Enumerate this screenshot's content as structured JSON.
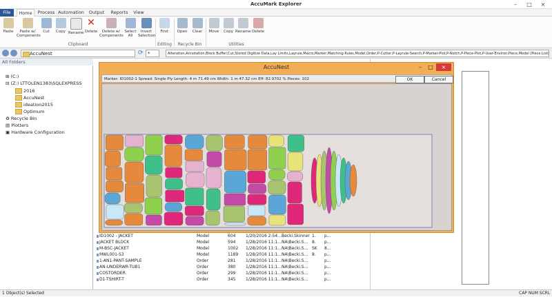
{
  "app": {
    "title": "AccuMark Explorer"
  },
  "tabs": [
    {
      "label": "File"
    },
    {
      "label": "Home"
    },
    {
      "label": "Process"
    },
    {
      "label": "Automation"
    },
    {
      "label": "Output"
    },
    {
      "label": "Reports"
    },
    {
      "label": "View"
    }
  ],
  "ribbon": {
    "clipboard": {
      "group_label": "Clipboard",
      "buttons": [
        "Paste",
        "Paste w/ Components",
        "Cut",
        "Copy",
        "Rename",
        "Delete",
        "Delete w/ Components",
        "Select All",
        "Invert Selection"
      ]
    },
    "editing": {
      "group_label": "Editing",
      "buttons": [
        "Find"
      ]
    },
    "recycle": {
      "group_label": "Recycle Bin",
      "buttons": [
        "Open",
        "Clear"
      ]
    },
    "utilities": {
      "group_label": "Utilities",
      "buttons": [
        "Move",
        "Copy",
        "Rename",
        "Delete"
      ]
    }
  },
  "address": {
    "location": "AccuNest",
    "filter": "*",
    "types": "Alteration,Annotation,Block Buffer,Cut,Stored Digitize Data,Lay Limits,Layrule,Macro,Marker,Matching Rules,Model,Order,P-Cutter,P-Layrule-Search,P-Marker-Plot,P-Notch,P-Piece-Plot,P-User-Environ,Piece,Model (Piece List),Plot,Ru"
  },
  "tree": {
    "header": "All Folders",
    "items": [
      {
        "label": "(C:)"
      },
      {
        "label": "(Z:) LTTOLEN1383\\SQLEXPRESS"
      },
      {
        "label": "2016"
      },
      {
        "label": "AccuNest"
      },
      {
        "label": "ideation2015"
      },
      {
        "label": "Optimum"
      },
      {
        "label": "Recycle Bin"
      },
      {
        "label": "Plotters"
      },
      {
        "label": "Hardware Configuration"
      }
    ]
  },
  "files": [
    {
      "name": "ID1002 - JACKET",
      "type": "Model",
      "size": "604",
      "date": "1/20/2016 2:54...",
      "owner": "Becki.Skinner",
      "c1": "1.",
      "c2": "p..."
    },
    {
      "name": "JACKET BLOCK",
      "type": "Model",
      "size": "594",
      "date": "1/28/2016 11:1...",
      "owner": "NA\\Becki.S...",
      "c1": "8.",
      "c2": "p..."
    },
    {
      "name": "M-BSC-JACKET",
      "type": "Model",
      "size": "1002",
      "date": "1/28/2016 11:1...",
      "owner": "NA\\Becki.S...",
      "c1": "SK",
      "c2": "8..."
    },
    {
      "name": "MWL001-S3",
      "type": "Model",
      "size": "1189",
      "date": "1/28/2016 11:1...",
      "owner": "NA\\Becki.S...",
      "c1": "8.",
      "c2": "p..."
    },
    {
      "name": "1-AN1-PANT-SAMPLE",
      "type": "Order",
      "size": "281",
      "date": "1/28/2016 11:1...",
      "owner": "NA\\Becki.S...",
      "c1": "",
      "c2": "p..."
    },
    {
      "name": "AN-UNDERWR-TUB1",
      "type": "Order",
      "size": "380",
      "date": "1/28/2016 11:1...",
      "owner": "NA\\Becki.S...",
      "c1": "",
      "c2": "p..."
    },
    {
      "name": "COSTORDER",
      "type": "Order",
      "size": "299",
      "date": "1/28/2016 11:1...",
      "owner": "NA\\Becki.S...",
      "c1": "",
      "c2": "p..."
    },
    {
      "name": "D1-TSHIRT-T",
      "type": "Order",
      "size": "345",
      "date": "1/28/2016 11:1...",
      "owner": "NA\\Becki.S...",
      "c1": "",
      "c2": "p..."
    }
  ],
  "status": {
    "left": "1 Object(s) Selected",
    "right": "CAP NUM SCRL"
  },
  "dialog": {
    "title": "AccuNest",
    "info": "Marker: ID1002-1   Spread: Single Ply   Length: 4 m 71.49 cm   Width: 1 m 47.32 cm   Eff: 82.9702 %   Pieces: 102",
    "ok_label": "OK",
    "cancel_label": "Cancel"
  },
  "colors": {
    "file_tab": "#2b5797",
    "dialog_frame": "#f2ad55",
    "marker_bg": "#d8d2d0",
    "close_button": "#d63b3b",
    "piece_colors": [
      "#e0287a",
      "#5aa6d6",
      "#8fd14f",
      "#e8e27a",
      "#e58a3c",
      "#c9e8f7",
      "#a8c46e",
      "#e5b3cf",
      "#3fbf8a",
      "#c44aa8"
    ]
  }
}
